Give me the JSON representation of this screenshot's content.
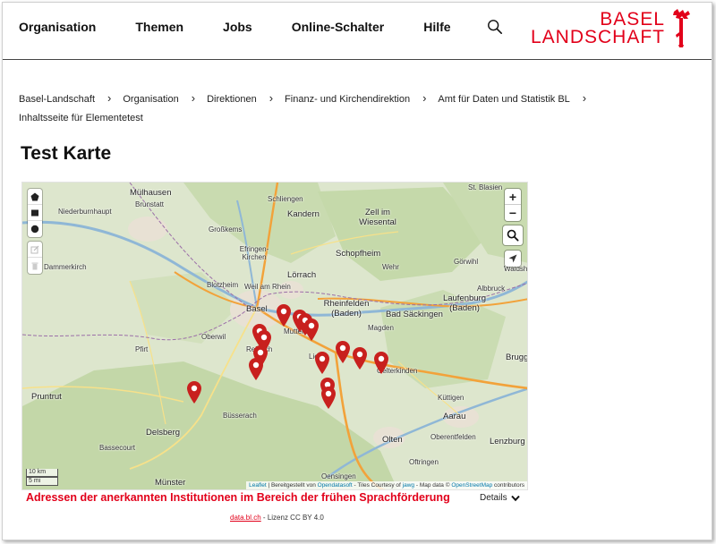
{
  "header": {
    "nav": [
      "Organisation",
      "Themen",
      "Jobs",
      "Online-Schalter",
      "Hilfe"
    ],
    "logo_line1": "BASEL",
    "logo_line2": "LANDSCHAFT",
    "brand_color": "#e2001a"
  },
  "breadcrumb": {
    "items": [
      "Basel-Landschaft",
      "Organisation",
      "Direktionen",
      "Finanz- und Kirchendirektion",
      "Amt für Daten und Statistik BL",
      "Inhaltsseite für Elementetest"
    ],
    "separator": "›"
  },
  "page_title": "Test Karte",
  "map": {
    "labels": [
      "Mülhausen",
      "Brunstatt",
      "Niederburnhaupt",
      "Dammerkirch",
      "Großkems",
      "Efringen-Kirchen",
      "Kandern",
      "Zell im Wiesental",
      "Schopfheim",
      "St. Blasien",
      "Wehr",
      "Görwihl",
      "Blotzheim",
      "Lörrach",
      "Weil am Rhein",
      "Basel",
      "Rheinfelden (Baden)",
      "Bad Säckingen",
      "Laufenburg (Baden)",
      "Albbruck",
      "Waldshut",
      "Oberwil",
      "Reinach",
      "Muttenz",
      "Magden",
      "Gelterkinden",
      "Pfirt",
      "Pruntrut",
      "Delsberg",
      "Büsserach",
      "Bassecourt",
      "Münster",
      "Küttigen",
      "Aarau",
      "Lenzburg",
      "Brugg",
      "Oberentfelden",
      "Olten",
      "Oftringen",
      "Oensingen",
      "Schliengen",
      "Lie"
    ],
    "scale_km": "10 km",
    "scale_mi": "5 mi",
    "attribution": {
      "leaflet": "Leaflet",
      "text1": " | Bereitgestellt von ",
      "opendatasoft": "Opendatasoft",
      "text2": " - Tiles Courtesy of ",
      "jawg": "jawg",
      "text3": " - Map data © ",
      "osm": "OpenStreetMap",
      "text4": " contributors"
    },
    "marker_color": "#c8201e"
  },
  "caption": "Adressen der anerkannten Institutionen im Bereich der frühen Sprachförderung",
  "details_label": "Details",
  "license": {
    "source": "data.bl.ch",
    "text": " - Lizenz CC BY 4.0"
  }
}
